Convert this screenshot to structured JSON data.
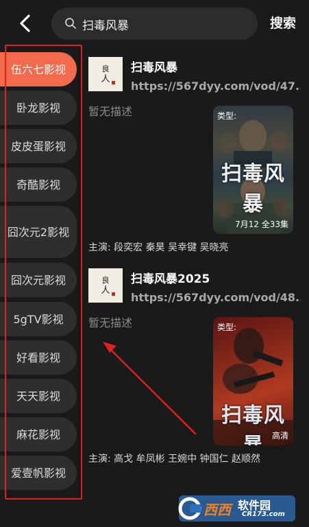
{
  "header": {
    "back_icon": "back-arrow-icon",
    "search_query": "扫毒风暴",
    "search_icon": "search-icon",
    "search_button": "搜索"
  },
  "sidebar": {
    "items": [
      {
        "label": "伍六七影视",
        "active": true
      },
      {
        "label": "卧龙影视",
        "active": false
      },
      {
        "label": "皮皮蛋影视",
        "active": false
      },
      {
        "label": "奇酷影视",
        "active": false
      },
      {
        "label": "囧次元2影视",
        "active": false
      },
      {
        "label": "囧次元影视",
        "active": false
      },
      {
        "label": "5gTV影视",
        "active": false
      },
      {
        "label": "好看影视",
        "active": false
      },
      {
        "label": "天天影视",
        "active": false
      },
      {
        "label": "麻花影视",
        "active": false
      },
      {
        "label": "爱壹帆影视",
        "active": false
      }
    ]
  },
  "results": [
    {
      "thumb_text": [
        "良",
        "人"
      ],
      "title": "扫毒风暴",
      "url": "https://567dyy.com/vod/47...",
      "description": "暂无描述",
      "poster_type": "类型:",
      "poster_title": "扫毒风暴",
      "poster_corner": "7月12 全33集",
      "cast": "主演: 段奕宏 秦昊 吴幸键 吴晓亮"
    },
    {
      "thumb_text": [
        "良",
        "人"
      ],
      "title": "扫毒风暴2025",
      "url": "https://567dyy.com/vod/48...",
      "description": "暂无描述",
      "poster_type": "类型:",
      "poster_title": "扫毒风暴",
      "poster_corner": "高清",
      "cast": "主演: 高戈 牟凤彬 王婉中 钟国仁 赵顺然"
    }
  ],
  "watermark": {
    "brand": "西西",
    "site_name": "软件园",
    "site_url": "CR173.com"
  },
  "colors": {
    "accent": "#f36a4c",
    "highlight_box": "#e0201e",
    "background": "#1a1a1a"
  }
}
